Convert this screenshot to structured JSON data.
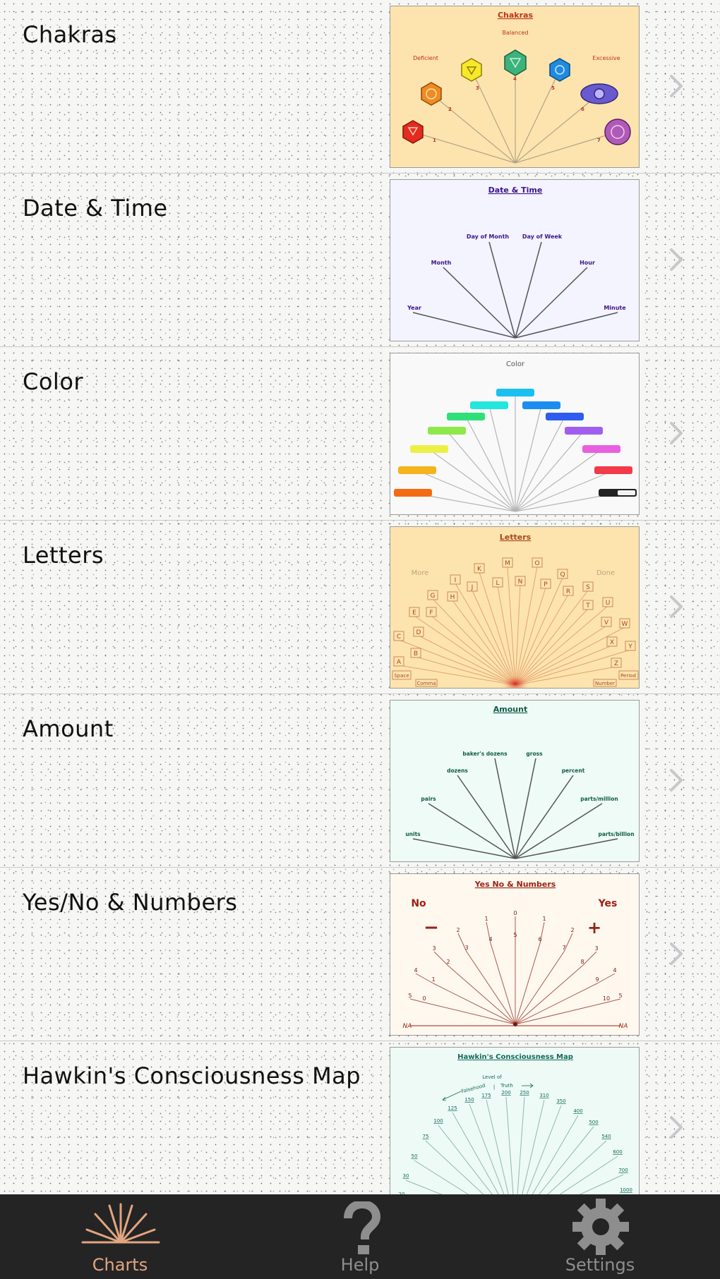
{
  "rows": [
    {
      "title": "Chakras",
      "thumb": {
        "title": "Chakras",
        "bg": "#fde4ae",
        "title_color": "#c0311b",
        "labels": [
          "Balanced",
          "Deficient",
          "Excessive",
          "1",
          "2",
          "3",
          "4",
          "5",
          "6",
          "7"
        ]
      }
    },
    {
      "title": "Date & Time",
      "thumb": {
        "title": "Date & Time",
        "bg": "#f3f4ff",
        "title_color": "#3f138c",
        "labels": [
          "Year",
          "Month",
          "Day of Month",
          "Day of Week",
          "Hour",
          "Minute"
        ]
      }
    },
    {
      "title": "Color",
      "thumb": {
        "title": "Color",
        "bg": "#f9f9f9",
        "title_color": "#555555"
      }
    },
    {
      "title": "Letters",
      "thumb": {
        "title": "Letters",
        "bg": "#fde4ae",
        "title_color": "#a8461b",
        "labels": [
          "More",
          "Done",
          "Space",
          "Comma",
          "Number",
          "Period",
          "A",
          "B",
          "C",
          "D",
          "E",
          "F",
          "G",
          "H",
          "I",
          "J",
          "K",
          "L",
          "M",
          "N",
          "O",
          "P",
          "Q",
          "R",
          "S",
          "T",
          "U",
          "V",
          "W",
          "X",
          "Y",
          "Z"
        ]
      }
    },
    {
      "title": "Amount",
      "thumb": {
        "title": "Amount",
        "bg": "#effbf6",
        "title_color": "#0f5b46",
        "labels": [
          "units",
          "pairs",
          "dozens",
          "baker's dozens",
          "gross",
          "percent",
          "parts/million",
          "parts/billion"
        ]
      }
    },
    {
      "title": "Yes/No & Numbers",
      "thumb": {
        "title": "Yes No & Numbers",
        "bg": "#fff8ef",
        "title_color": "#9b1f12",
        "labels": [
          "No",
          "Yes",
          "−",
          "+",
          "NA",
          "NA",
          "5",
          "4",
          "3",
          "2",
          "1",
          "0",
          "1",
          "2",
          "3",
          "4",
          "5",
          "0",
          "1",
          "2",
          "3",
          "4",
          "5",
          "6",
          "7",
          "8",
          "9",
          "10"
        ]
      }
    },
    {
      "title": "Hawkin's Consciousness Map",
      "thumb": {
        "title": "Hawkin's Consciousness Map",
        "bg": "#eefaf6",
        "title_color": "#0f6b5a",
        "labels": [
          "Level of",
          "Falsehood",
          "|",
          "Truth",
          "20",
          "30",
          "50",
          "75",
          "100",
          "125",
          "150",
          "175",
          "200",
          "250",
          "310",
          "350",
          "400",
          "500",
          "540",
          "600",
          "700",
          "1000"
        ]
      }
    }
  ],
  "tabs": [
    {
      "label": "Charts",
      "icon": "charts-fan-icon",
      "active": true
    },
    {
      "label": "Help",
      "icon": "question-mark-icon",
      "active": false
    },
    {
      "label": "Settings",
      "icon": "gear-icon",
      "active": false
    }
  ],
  "colors": {
    "accent": "#e1a581",
    "tabbar_bg": "#242424",
    "tab_inactive": "#8e8e8e",
    "chevron": "#c7c7cc"
  }
}
